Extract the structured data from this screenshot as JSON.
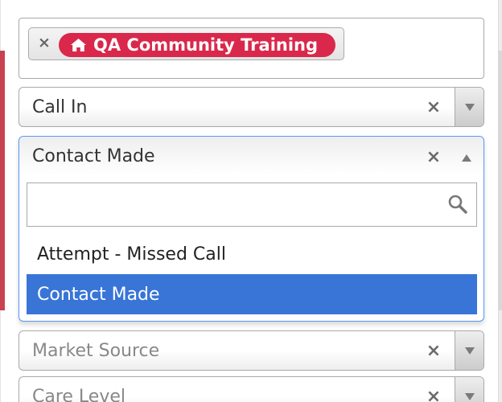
{
  "tags": {
    "remove_symbol": "×",
    "items": [
      {
        "label": "QA Community Training",
        "icon": "home-icon",
        "color": "#d9284b"
      }
    ]
  },
  "call_type": {
    "value": "Call In",
    "clear_symbol": "×"
  },
  "outcome": {
    "value": "Contact Made",
    "clear_symbol": "×",
    "search": {
      "value": "",
      "placeholder": ""
    },
    "options": [
      {
        "label": "Attempt - Missed Call",
        "highlighted": false
      },
      {
        "label": "Contact Made",
        "highlighted": true
      }
    ],
    "highlight_color": "#3875d7",
    "focus_border_color": "#5897fb"
  },
  "market_source": {
    "placeholder": "Market Source",
    "clear_symbol": "×"
  },
  "care_level": {
    "placeholder": "Care Level",
    "clear_symbol": "×"
  }
}
